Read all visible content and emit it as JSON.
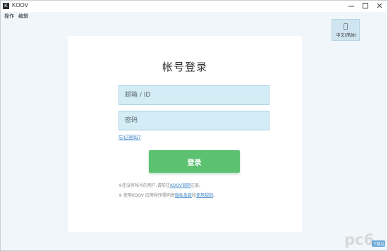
{
  "window": {
    "app_icon_glyph": "K",
    "title": "KOOV"
  },
  "menu": {
    "items": [
      "操作",
      "编辑"
    ]
  },
  "language": {
    "icon": "phone-icon",
    "label": "中文(简体)"
  },
  "login": {
    "title": "帐号登录",
    "email_placeholder": "邮箱 / ID",
    "password_placeholder": "密码",
    "forgot_link": "忘记密码?",
    "submit_label": "登录",
    "register_note_prefix": "※还没有帐号的用户,请前往",
    "register_link": "KOOV官网",
    "register_note_suffix": "注册。",
    "terms_prefix": "※ 使用KOOV 应用程序需同意",
    "privacy_link": "隐私条款",
    "terms_and": "和",
    "terms_link": "使用规则",
    "terms_suffix": "。"
  },
  "watermark": {
    "text": "pc6",
    "sub": "下载站"
  },
  "colors": {
    "accent_green": "#5cc170",
    "field_bg": "#d4ecf5",
    "link_blue": "#3c86c9",
    "page_bg": "#f0f6fa"
  }
}
